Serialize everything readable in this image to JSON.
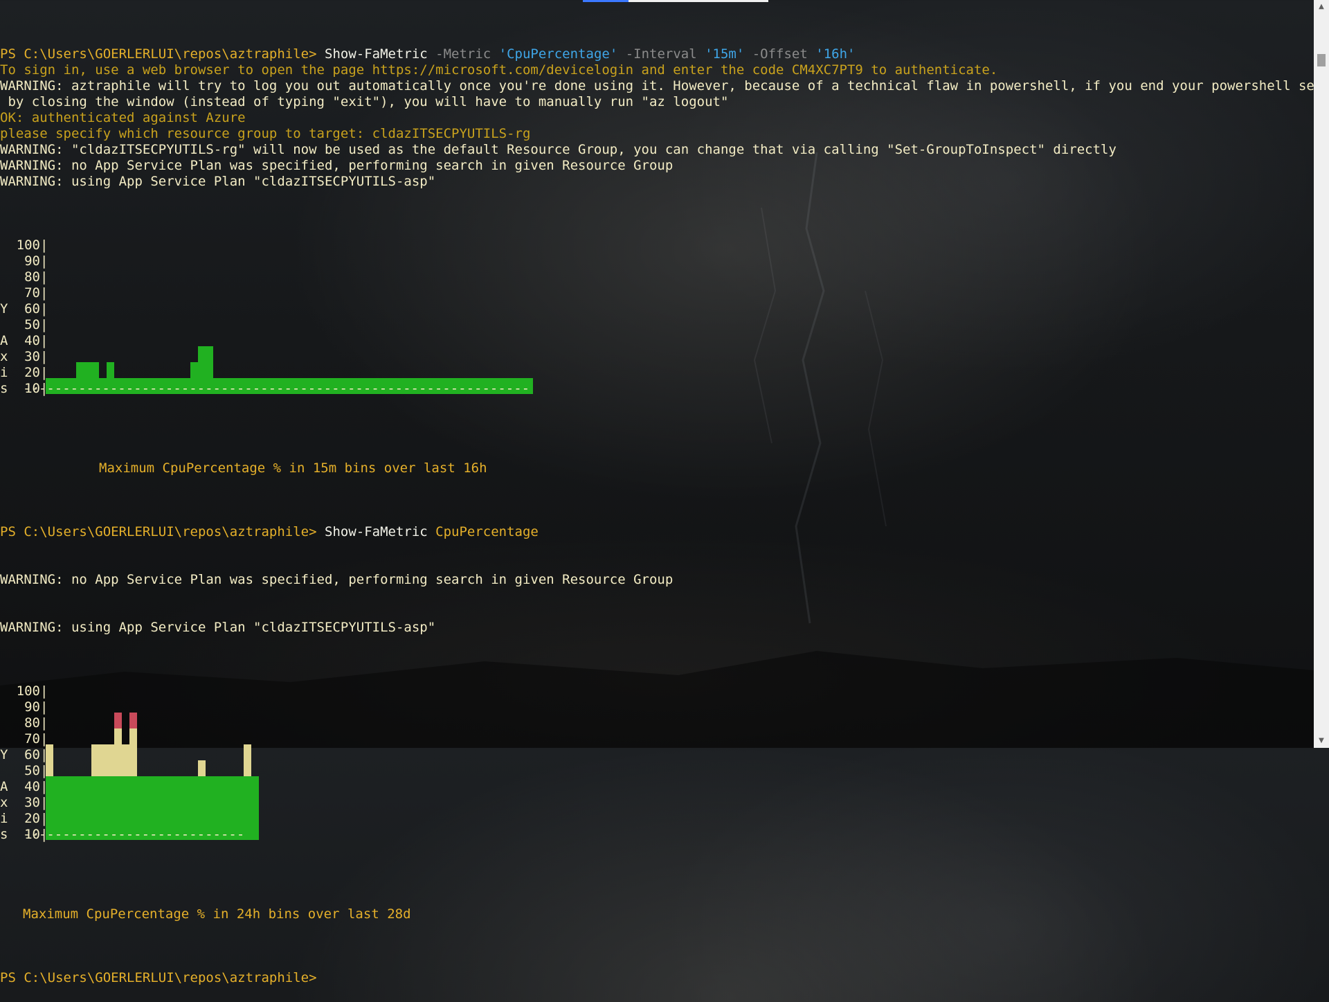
{
  "terminal": {
    "lines": [
      {
        "kind": "prompt",
        "prompt": "PS C:\\Users\\GOERLERLUI\\repos\\aztraphile> ",
        "segments": [
          {
            "cls": "cmd",
            "text": "Show-FaMetric "
          },
          {
            "cls": "param",
            "text": "-Metric "
          },
          {
            "cls": "str",
            "text": "'CpuPercentage' "
          },
          {
            "cls": "param",
            "text": "-Interval "
          },
          {
            "cls": "str",
            "text": "'15m' "
          },
          {
            "cls": "param",
            "text": "-Offset "
          },
          {
            "cls": "str",
            "text": "'16h'"
          }
        ]
      },
      {
        "kind": "text",
        "cls": "info",
        "text": "To sign in, use a web browser to open the page https://microsoft.com/devicelogin and enter the code CM4XC7PT9 to authenticate."
      },
      {
        "kind": "text",
        "cls": "warn",
        "text": "WARNING: aztraphile will try to log you out automatically once you're done using it. However, because of a technical flaw in powershell, if you end your powershell session"
      },
      {
        "kind": "text",
        "cls": "warn",
        "text": " by closing the window (instead of typing \"exit\"), you will have to manually run \"az logout\""
      },
      {
        "kind": "text",
        "cls": "info",
        "text": "OK: authenticated against Azure"
      },
      {
        "kind": "text",
        "cls": "info",
        "text": "please specify which resource group to target: cldazITSECPYUTILS-rg"
      },
      {
        "kind": "text",
        "cls": "warn",
        "text": "WARNING: \"cldazITSECPYUTILS-rg\" will now be used as the default Resource Group, you can change that via calling \"Set-GroupToInspect\" directly"
      },
      {
        "kind": "text",
        "cls": "warn",
        "text": "WARNING: no App Service Plan was specified, performing search in given Resource Group"
      },
      {
        "kind": "text",
        "cls": "warn",
        "text": "WARNING: using App Service Plan \"cldazITSECPYUTILS-asp\""
      }
    ],
    "second_command": {
      "prompt": "PS C:\\Users\\GOERLERLUI\\repos\\aztraphile> ",
      "segments": [
        {
          "cls": "cmd",
          "text": "Show-FaMetric "
        },
        {
          "cls": "arg",
          "text": "CpuPercentage"
        }
      ]
    },
    "second_warnings": [
      "WARNING: no App Service Plan was specified, performing search in given Resource Group",
      "WARNING: using App Service Plan \"cldazITSECPYUTILS-asp\""
    ],
    "final_prompt": "PS C:\\Users\\GOERLERLUI\\repos\\aztraphile> "
  },
  "axis": {
    "ticks": [
      "100",
      "90",
      "80",
      "70",
      "60",
      "50",
      "40",
      "30",
      "20",
      "10"
    ],
    "letters": [
      "",
      "",
      "",
      "",
      "Y",
      "",
      "A",
      "x",
      "i",
      "s"
    ]
  },
  "colors": {
    "green": "#21b121",
    "yellow": "#e0d692",
    "red": "#c84a5a"
  },
  "chart_data": [
    {
      "type": "bar",
      "title": "Maximum CpuPercentage % in 15m bins over last 16h",
      "ylim": [
        0,
        100
      ],
      "ylabel": "Y Axis",
      "dashes": "----------------------------------------------------------------",
      "series": [
        {
          "values": [
            10,
            10,
            10,
            10,
            20,
            20,
            20,
            10,
            20,
            10,
            10,
            10,
            10,
            10,
            10,
            10,
            10,
            10,
            10,
            20,
            30,
            30,
            10,
            10,
            10,
            10,
            10,
            10,
            10,
            10,
            10,
            10,
            10,
            10,
            10,
            10,
            10,
            10,
            10,
            10,
            10,
            10,
            10,
            10,
            10,
            10,
            10,
            10,
            10,
            10,
            10,
            10,
            10,
            10,
            10,
            10,
            10,
            10,
            10,
            10,
            10,
            10,
            10,
            10
          ]
        }
      ]
    },
    {
      "type": "bar",
      "title": "Maximum CpuPercentage % in 24h bins over last 28d",
      "ylim": [
        0,
        100
      ],
      "ylabel": "Y Axis",
      "dashes": "----------------------------",
      "series": [
        {
          "values": [
            60,
            40,
            40,
            40,
            40,
            40,
            60,
            60,
            60,
            80,
            60,
            80,
            40,
            40,
            40,
            40,
            40,
            40,
            40,
            40,
            50,
            40,
            40,
            40,
            40,
            40,
            60,
            40
          ]
        }
      ]
    }
  ]
}
